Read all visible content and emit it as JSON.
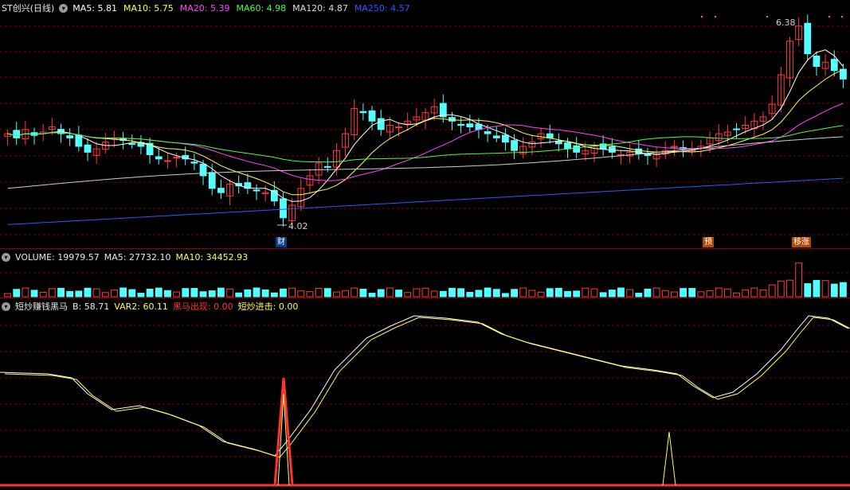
{
  "price_panel": {
    "stock_name": "ST创兴",
    "period": "(日线)",
    "indicators": [
      {
        "label": "MA5:",
        "value": "5.81",
        "color": "#ffffff"
      },
      {
        "label": "MA10:",
        "value": "5.75",
        "color": "#ffff55"
      },
      {
        "label": "MA20:",
        "value": "5.39",
        "color": "#ff44ff"
      },
      {
        "label": "MA60:",
        "value": "4.98",
        "color": "#44ff44"
      },
      {
        "label": "MA120:",
        "value": "4.87",
        "color": "#dddddd"
      },
      {
        "label": "MA250:",
        "value": "4.57",
        "color": "#3355ff"
      }
    ],
    "high_label": "6.38",
    "low_label": "4.02",
    "markers": [
      "财",
      "预",
      "移涨"
    ]
  },
  "volume_panel": {
    "title": "VOLUME: 19979.57",
    "ma5": "MA5: 27732.10",
    "ma10": "MA10: 34452.93"
  },
  "indicator_panel": {
    "name": "短炒赚钱黑马",
    "b": "B: 58.71",
    "var2": "VAR2: 60.11",
    "heima": "黑马出现: 0.00",
    "jinji": "短炒进击: 0.00"
  },
  "colors": {
    "up": "#ff3b3b",
    "down": "#54ffff",
    "grid": "#7a0000"
  },
  "chart_data": {
    "type": "candlestick",
    "price_range": [
      3.9,
      6.5
    ],
    "close_series": [
      5.1,
      5.05,
      5.15,
      5.08,
      5.12,
      5.18,
      5.1,
      5.05,
      4.95,
      4.88,
      4.92,
      5.0,
      5.05,
      5.02,
      4.98,
      4.95,
      4.85,
      4.8,
      4.78,
      4.82,
      4.8,
      4.75,
      4.6,
      4.45,
      4.4,
      4.5,
      4.48,
      4.45,
      4.42,
      4.4,
      4.3,
      4.1,
      4.25,
      4.45,
      4.6,
      4.75,
      4.7,
      4.9,
      5.1,
      5.4,
      5.35,
      5.25,
      5.15,
      5.2,
      5.18,
      5.25,
      5.3,
      5.35,
      5.42,
      5.3,
      5.25,
      5.2,
      5.18,
      5.15,
      5.1,
      5.05,
      5.0,
      4.9,
      4.95,
      5.0,
      5.1,
      5.05,
      4.98,
      4.92,
      4.88,
      4.9,
      4.95,
      4.92,
      4.88,
      4.85,
      4.88,
      4.86,
      4.84,
      4.85,
      4.9,
      4.95,
      4.92,
      4.9,
      4.95,
      5.05,
      5.1,
      5.12,
      5.15,
      5.2,
      5.25,
      5.3,
      5.45,
      5.8,
      6.2,
      6.38,
      6.05,
      5.9,
      5.95,
      5.85,
      5.75
    ],
    "ma250_range": [
      4.02,
      4.57
    ],
    "signal_peaks": [
      "财",
      "预"
    ]
  }
}
